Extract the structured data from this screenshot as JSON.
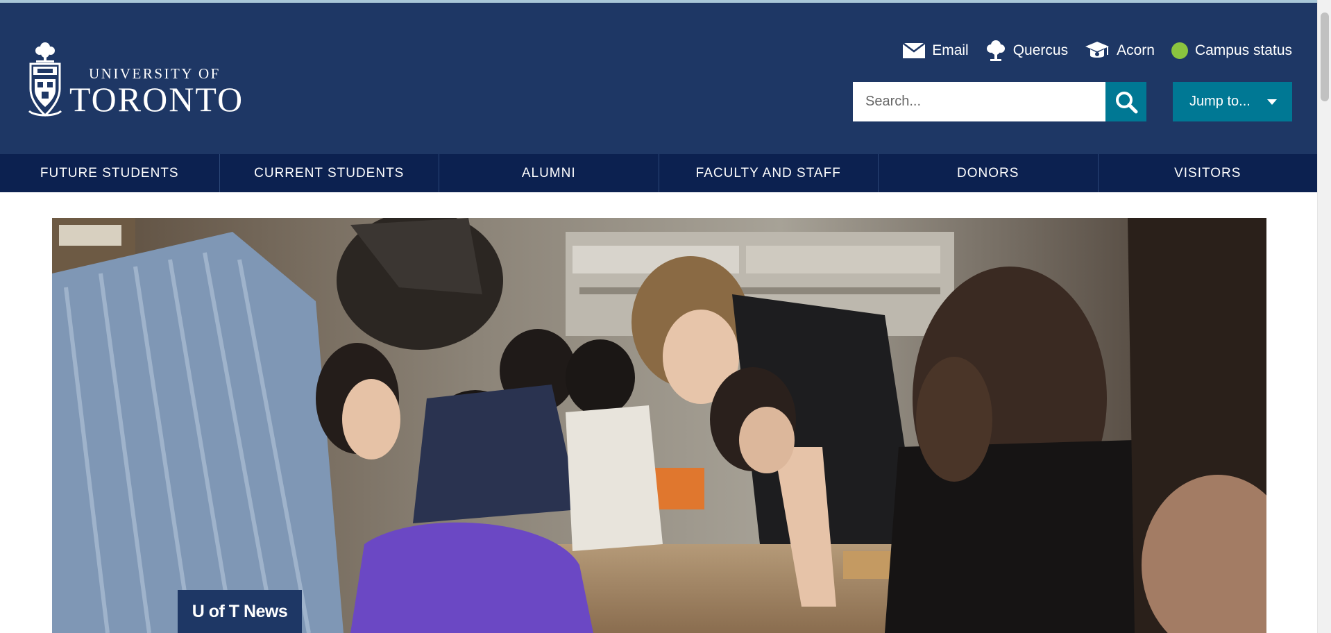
{
  "logo": {
    "line1": "UNIVERSITY OF",
    "line2": "TORONTO"
  },
  "quick_links": [
    {
      "label": "Email",
      "icon": "envelope-icon"
    },
    {
      "label": "Quercus",
      "icon": "tree-icon"
    },
    {
      "label": "Acorn",
      "icon": "graduation-cap-icon"
    },
    {
      "label": "Campus status",
      "icon": "status-dot-icon",
      "status_color": "#8bc53f"
    }
  ],
  "search": {
    "placeholder": "Search..."
  },
  "jump": {
    "label": "Jump to..."
  },
  "nav": {
    "items": [
      {
        "label": "FUTURE STUDENTS"
      },
      {
        "label": "CURRENT STUDENTS"
      },
      {
        "label": "ALUMNI"
      },
      {
        "label": "FACULTY AND STAFF"
      },
      {
        "label": "DONORS"
      },
      {
        "label": "VISITORS"
      }
    ]
  },
  "hero": {
    "badge": "U of T News"
  },
  "colors": {
    "header_bg": "#1e3765",
    "nav_bg": "#0c2150",
    "accent": "#007894",
    "status_green": "#8bc53f"
  }
}
